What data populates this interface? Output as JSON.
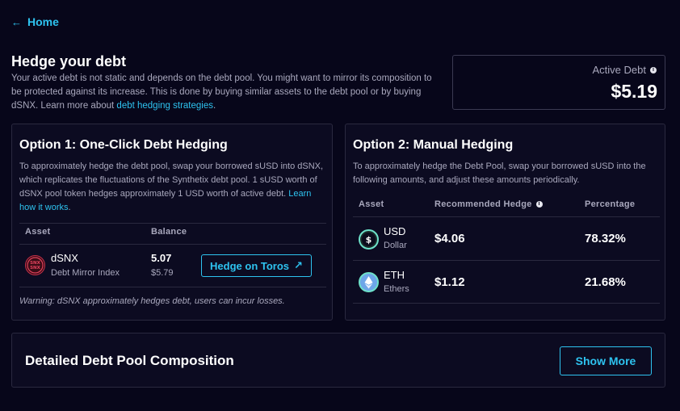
{
  "nav": {
    "home_label": "Home"
  },
  "header": {
    "title": "Hedge your debt",
    "description": "Your active debt is not static and depends on the debt pool. You might want to mirror its composition to be protected against its increase. This is done by buying similar assets to the debt pool or by buying dSNX. Learn more about ",
    "link_text": "debt hedging strategies",
    "after_link": "."
  },
  "active_debt": {
    "label": "Active Debt",
    "value": "$5.19"
  },
  "option1": {
    "title": "Option 1: One-Click Debt Hedging",
    "description": "To approximately hedge the debt pool, swap your borrowed sUSD into dSNX, which replicates the fluctuations of the Synthetix debt pool. 1 sUSD worth of dSNX pool token hedges approximately 1 USD worth of active debt. ",
    "link_text": "Learn how it works",
    "after_link": ".",
    "columns": [
      "Asset",
      "Balance"
    ],
    "row": {
      "name": "dSNX",
      "sub": "Debt Mirror Index",
      "balance": "5.07",
      "balance_usd": "$5.79",
      "button_label": "Hedge on Toros"
    },
    "warning": "Warning: dSNX approximately hedges debt, users can incur losses."
  },
  "option2": {
    "title": "Option 2: Manual Hedging",
    "description": "To approximately hedge the Debt Pool, swap your borrowed sUSD into the following amounts, and adjust these amounts periodically.",
    "columns": [
      "Asset",
      "Recommended Hedge",
      "Percentage"
    ],
    "rows": [
      {
        "name": "USD",
        "sub": "Dollar",
        "hedge": "$4.06",
        "percentage": "78.32%"
      },
      {
        "name": "ETH",
        "sub": "Ethers",
        "hedge": "$1.12",
        "percentage": "21.68%"
      }
    ]
  },
  "detailed": {
    "title": "Detailed Debt Pool Composition",
    "button_label": "Show More"
  },
  "colors": {
    "accent": "#2ec3f0",
    "background": "#07061a",
    "card": "#0c0b21",
    "border": "#2a293f",
    "muted": "#a9a8bd"
  }
}
